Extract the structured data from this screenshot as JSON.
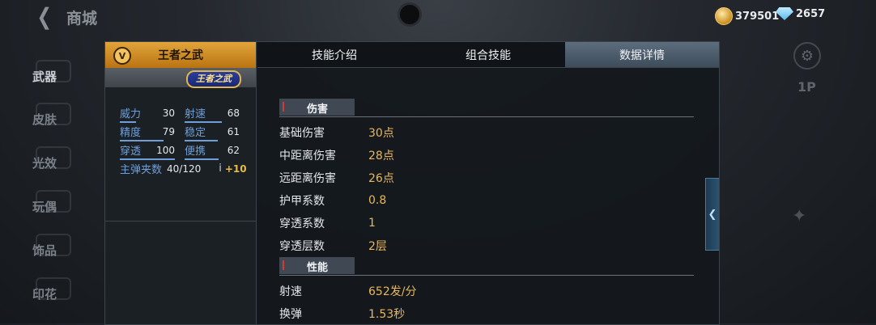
{
  "header": {
    "back_icon": "chevron-left-icon",
    "title": "商城",
    "coins": "379501",
    "diamonds": "2657"
  },
  "categories": [
    {
      "label": "武器"
    },
    {
      "label": "皮肤"
    },
    {
      "label": "光效"
    },
    {
      "label": "玩偶"
    },
    {
      "label": "饰品"
    },
    {
      "label": "印花"
    }
  ],
  "weapon": {
    "rank": "V",
    "name": "王者之武",
    "badge": "王者之武",
    "stats": [
      [
        {
          "k": "威力",
          "v": "30",
          "bar": 0.3
        },
        {
          "k": "射速",
          "v": "68",
          "bar": 0.68
        }
      ],
      [
        {
          "k": "精度",
          "v": "79",
          "bar": 0.79
        },
        {
          "k": "稳定",
          "v": "61",
          "bar": 0.61
        }
      ],
      [
        {
          "k": "穿透",
          "v": "100",
          "bar": 1.0
        },
        {
          "k": "便携",
          "v": "62",
          "bar": 0.62
        }
      ]
    ],
    "ammo": {
      "k": "主弹夹数",
      "v": "40/120",
      "info": "i",
      "bonus": "+10"
    }
  },
  "tabs": [
    {
      "label": "技能介绍",
      "active": false
    },
    {
      "label": "组合技能",
      "active": false
    },
    {
      "label": "数据详情",
      "active": true
    }
  ],
  "details": {
    "sections": [
      {
        "title": "伤害",
        "rows": [
          {
            "k": "基础伤害",
            "v": "30点"
          },
          {
            "k": "中距离伤害",
            "v": "28点"
          },
          {
            "k": "远距离伤害",
            "v": "26点"
          },
          {
            "k": "护甲系数",
            "v": "0.8"
          },
          {
            "k": "穿透系数",
            "v": "1"
          },
          {
            "k": "穿透层数",
            "v": "2层"
          }
        ]
      },
      {
        "title": "性能",
        "rows": [
          {
            "k": "射速",
            "v": "652发/分"
          },
          {
            "k": "换弹",
            "v": "1.53秒"
          }
        ]
      }
    ]
  },
  "side": {
    "collapse_icon": "chevron-left-icon",
    "label_1p": "1P"
  },
  "colors": {
    "accent_gold": "#e2a43b",
    "value_text": "#e8b85a",
    "stat_blue": "#6f9fd8",
    "active_tab": "#5c6d7e"
  }
}
